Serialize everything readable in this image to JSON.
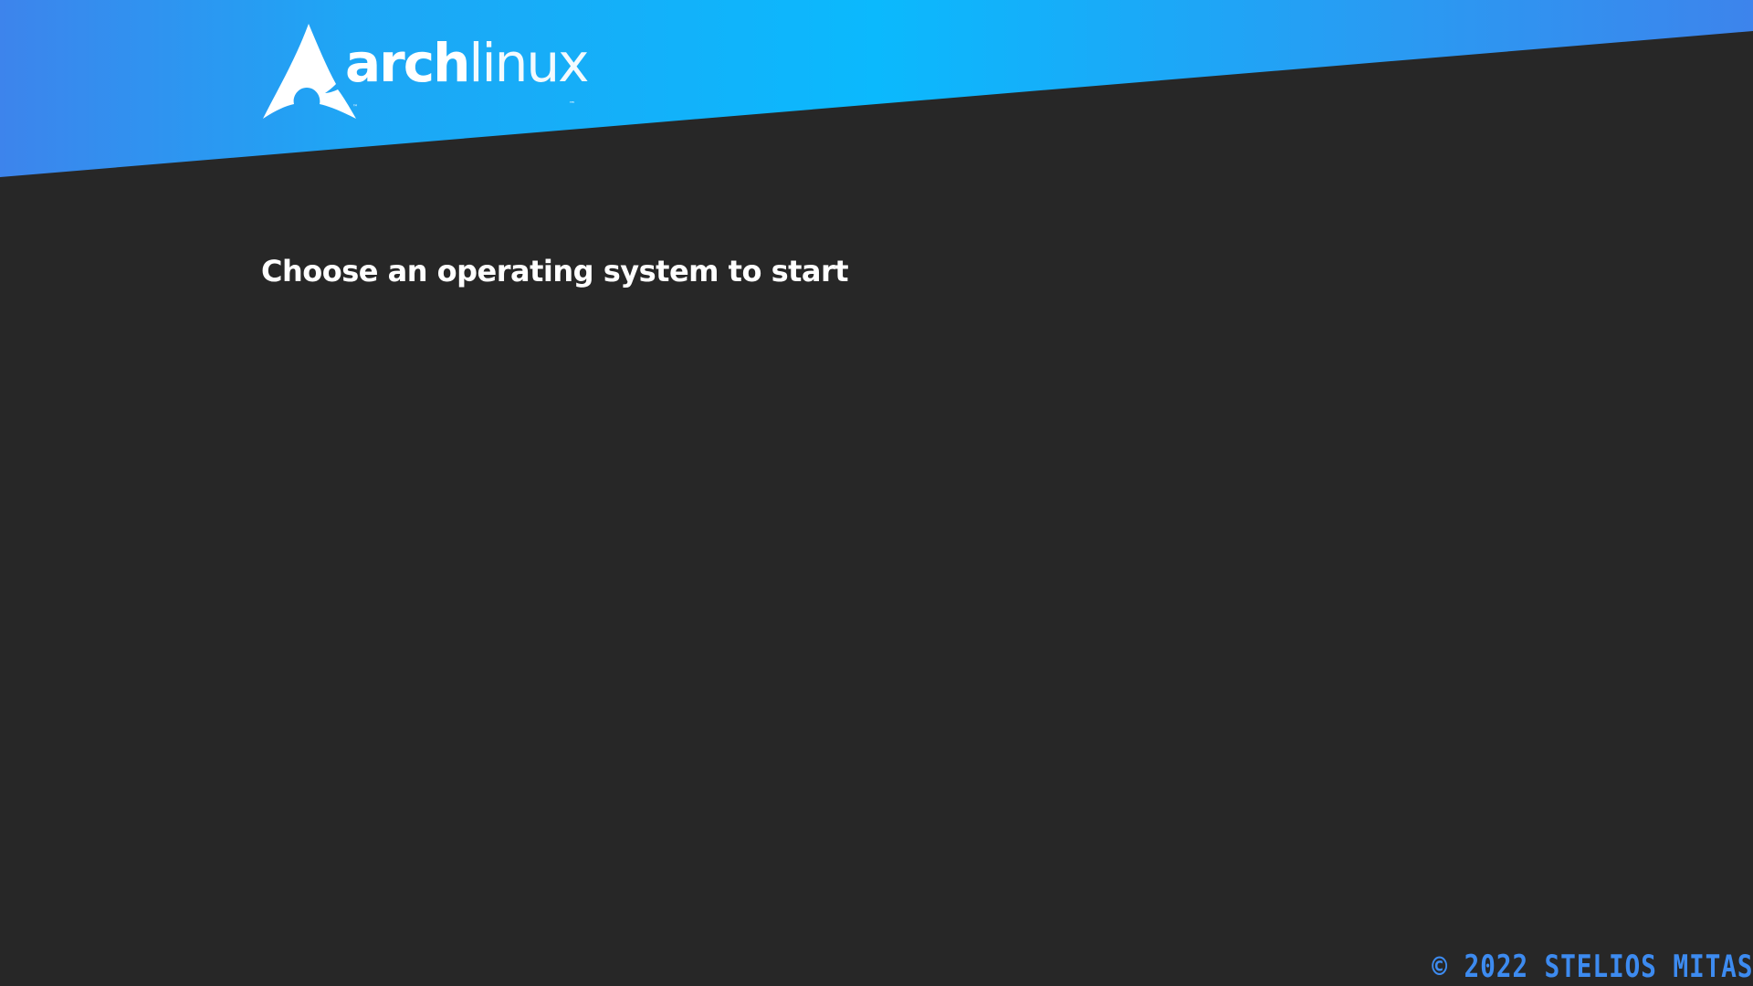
{
  "theme": {
    "background": "#272727",
    "banner_gradient": [
      "#3d84ec",
      "#1ea6f5",
      "#0bb9fd",
      "#2a9af2",
      "#3d84ec"
    ],
    "accent": "#3d8bf0",
    "text": "#ffffff"
  },
  "logo": {
    "brand_bold": "arch",
    "brand_light": "linux",
    "icon": "arch-linux-icon"
  },
  "menu": {
    "title": "Choose an operating system to start",
    "entries": []
  },
  "footer": {
    "copyright": "© 2022 STELIOS MITAS"
  }
}
